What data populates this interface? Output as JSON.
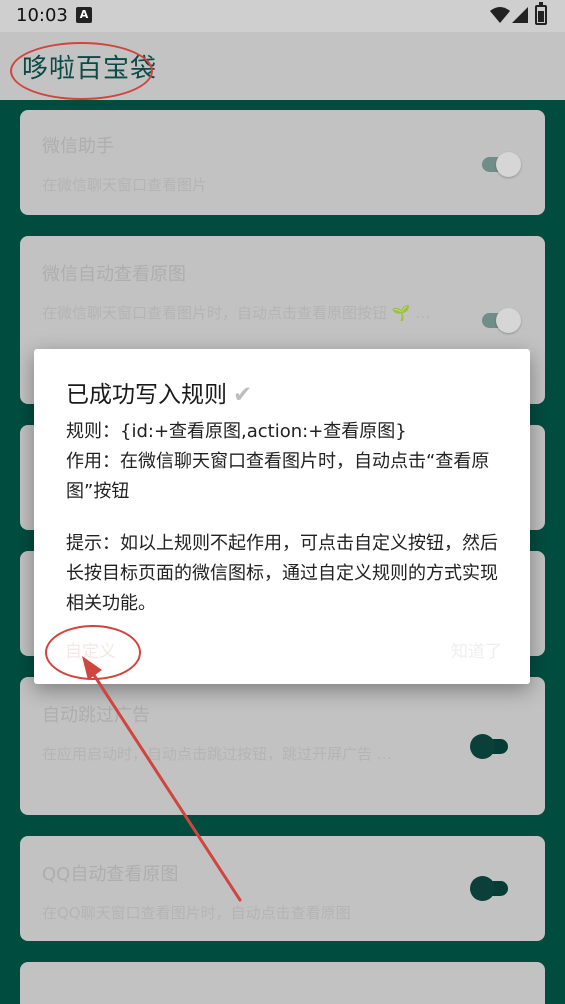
{
  "status_bar": {
    "time": "10:03",
    "notification_icon": "A"
  },
  "app_bar": {
    "title": "哆啦百宝袋"
  },
  "cards": [
    {
      "title": "微信助手",
      "desc": "在微信聊天窗口查看图片"
    },
    {
      "title": "微信自动查看原图",
      "desc": "在微信聊天窗口查看图片时，自动点击查看原图按钮 🌱 …"
    },
    {
      "title": "",
      "desc": ""
    },
    {
      "title": "",
      "desc": ""
    },
    {
      "title": "自动跳过广告",
      "desc": "在应用启动时，自动点击跳过按钮，跳过开屏广告 …"
    },
    {
      "title": "QQ自动查看原图",
      "desc": "在QQ聊天窗口查看图片时，自动点击查看原图"
    },
    {
      "title": "",
      "desc": ""
    }
  ],
  "dialog": {
    "title": "已成功写入规则",
    "title_icon": "✔",
    "rule_line": "规则：{id:+查看原图,action:+查看原图}",
    "effect_line": "作用：在微信聊天窗口查看图片时，自动点击“查看原图”按钮",
    "tip_line": "提示：如以上规则不起作用，可点击自定义按钮，然后长按目标页面的微信图标，通过自定义规则的方式实现相关功能。",
    "custom_button": "自定义",
    "ok_button": "知道了"
  },
  "colors": {
    "background": "#004D40",
    "annotation": "#d0453d"
  }
}
